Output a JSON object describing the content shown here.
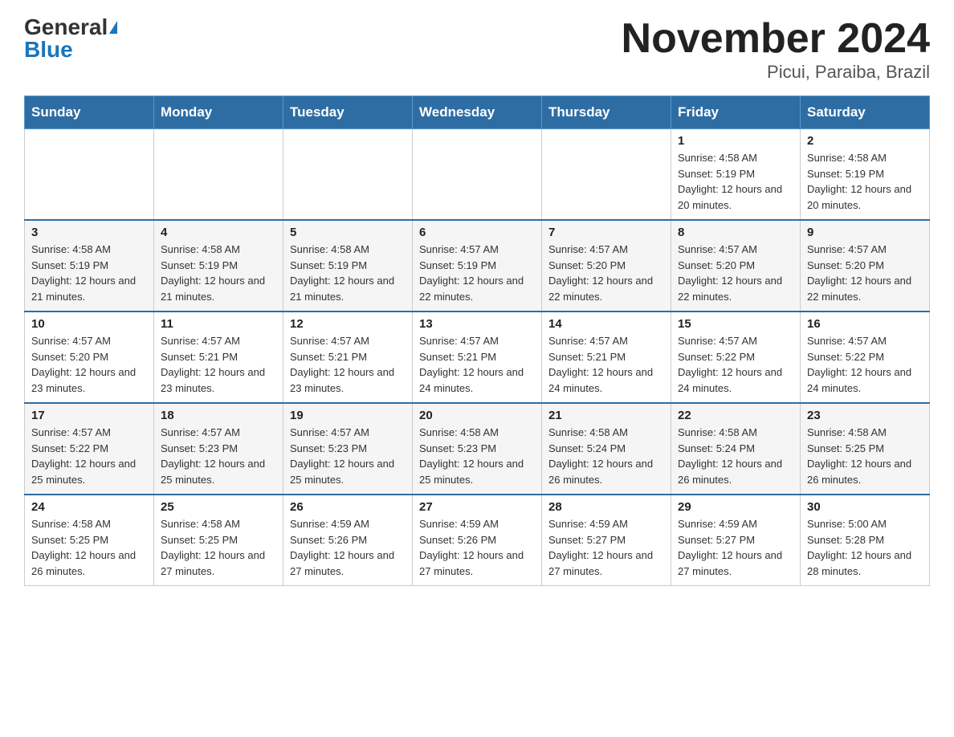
{
  "header": {
    "logo_general": "General",
    "logo_blue": "Blue",
    "month_title": "November 2024",
    "location": "Picui, Paraiba, Brazil"
  },
  "weekdays": [
    "Sunday",
    "Monday",
    "Tuesday",
    "Wednesday",
    "Thursday",
    "Friday",
    "Saturday"
  ],
  "weeks": [
    [
      {
        "day": "",
        "info": ""
      },
      {
        "day": "",
        "info": ""
      },
      {
        "day": "",
        "info": ""
      },
      {
        "day": "",
        "info": ""
      },
      {
        "day": "",
        "info": ""
      },
      {
        "day": "1",
        "info": "Sunrise: 4:58 AM\nSunset: 5:19 PM\nDaylight: 12 hours and 20 minutes."
      },
      {
        "day": "2",
        "info": "Sunrise: 4:58 AM\nSunset: 5:19 PM\nDaylight: 12 hours and 20 minutes."
      }
    ],
    [
      {
        "day": "3",
        "info": "Sunrise: 4:58 AM\nSunset: 5:19 PM\nDaylight: 12 hours and 21 minutes."
      },
      {
        "day": "4",
        "info": "Sunrise: 4:58 AM\nSunset: 5:19 PM\nDaylight: 12 hours and 21 minutes."
      },
      {
        "day": "5",
        "info": "Sunrise: 4:58 AM\nSunset: 5:19 PM\nDaylight: 12 hours and 21 minutes."
      },
      {
        "day": "6",
        "info": "Sunrise: 4:57 AM\nSunset: 5:19 PM\nDaylight: 12 hours and 22 minutes."
      },
      {
        "day": "7",
        "info": "Sunrise: 4:57 AM\nSunset: 5:20 PM\nDaylight: 12 hours and 22 minutes."
      },
      {
        "day": "8",
        "info": "Sunrise: 4:57 AM\nSunset: 5:20 PM\nDaylight: 12 hours and 22 minutes."
      },
      {
        "day": "9",
        "info": "Sunrise: 4:57 AM\nSunset: 5:20 PM\nDaylight: 12 hours and 22 minutes."
      }
    ],
    [
      {
        "day": "10",
        "info": "Sunrise: 4:57 AM\nSunset: 5:20 PM\nDaylight: 12 hours and 23 minutes."
      },
      {
        "day": "11",
        "info": "Sunrise: 4:57 AM\nSunset: 5:21 PM\nDaylight: 12 hours and 23 minutes."
      },
      {
        "day": "12",
        "info": "Sunrise: 4:57 AM\nSunset: 5:21 PM\nDaylight: 12 hours and 23 minutes."
      },
      {
        "day": "13",
        "info": "Sunrise: 4:57 AM\nSunset: 5:21 PM\nDaylight: 12 hours and 24 minutes."
      },
      {
        "day": "14",
        "info": "Sunrise: 4:57 AM\nSunset: 5:21 PM\nDaylight: 12 hours and 24 minutes."
      },
      {
        "day": "15",
        "info": "Sunrise: 4:57 AM\nSunset: 5:22 PM\nDaylight: 12 hours and 24 minutes."
      },
      {
        "day": "16",
        "info": "Sunrise: 4:57 AM\nSunset: 5:22 PM\nDaylight: 12 hours and 24 minutes."
      }
    ],
    [
      {
        "day": "17",
        "info": "Sunrise: 4:57 AM\nSunset: 5:22 PM\nDaylight: 12 hours and 25 minutes."
      },
      {
        "day": "18",
        "info": "Sunrise: 4:57 AM\nSunset: 5:23 PM\nDaylight: 12 hours and 25 minutes."
      },
      {
        "day": "19",
        "info": "Sunrise: 4:57 AM\nSunset: 5:23 PM\nDaylight: 12 hours and 25 minutes."
      },
      {
        "day": "20",
        "info": "Sunrise: 4:58 AM\nSunset: 5:23 PM\nDaylight: 12 hours and 25 minutes."
      },
      {
        "day": "21",
        "info": "Sunrise: 4:58 AM\nSunset: 5:24 PM\nDaylight: 12 hours and 26 minutes."
      },
      {
        "day": "22",
        "info": "Sunrise: 4:58 AM\nSunset: 5:24 PM\nDaylight: 12 hours and 26 minutes."
      },
      {
        "day": "23",
        "info": "Sunrise: 4:58 AM\nSunset: 5:25 PM\nDaylight: 12 hours and 26 minutes."
      }
    ],
    [
      {
        "day": "24",
        "info": "Sunrise: 4:58 AM\nSunset: 5:25 PM\nDaylight: 12 hours and 26 minutes."
      },
      {
        "day": "25",
        "info": "Sunrise: 4:58 AM\nSunset: 5:25 PM\nDaylight: 12 hours and 27 minutes."
      },
      {
        "day": "26",
        "info": "Sunrise: 4:59 AM\nSunset: 5:26 PM\nDaylight: 12 hours and 27 minutes."
      },
      {
        "day": "27",
        "info": "Sunrise: 4:59 AM\nSunset: 5:26 PM\nDaylight: 12 hours and 27 minutes."
      },
      {
        "day": "28",
        "info": "Sunrise: 4:59 AM\nSunset: 5:27 PM\nDaylight: 12 hours and 27 minutes."
      },
      {
        "day": "29",
        "info": "Sunrise: 4:59 AM\nSunset: 5:27 PM\nDaylight: 12 hours and 27 minutes."
      },
      {
        "day": "30",
        "info": "Sunrise: 5:00 AM\nSunset: 5:28 PM\nDaylight: 12 hours and 28 minutes."
      }
    ]
  ]
}
